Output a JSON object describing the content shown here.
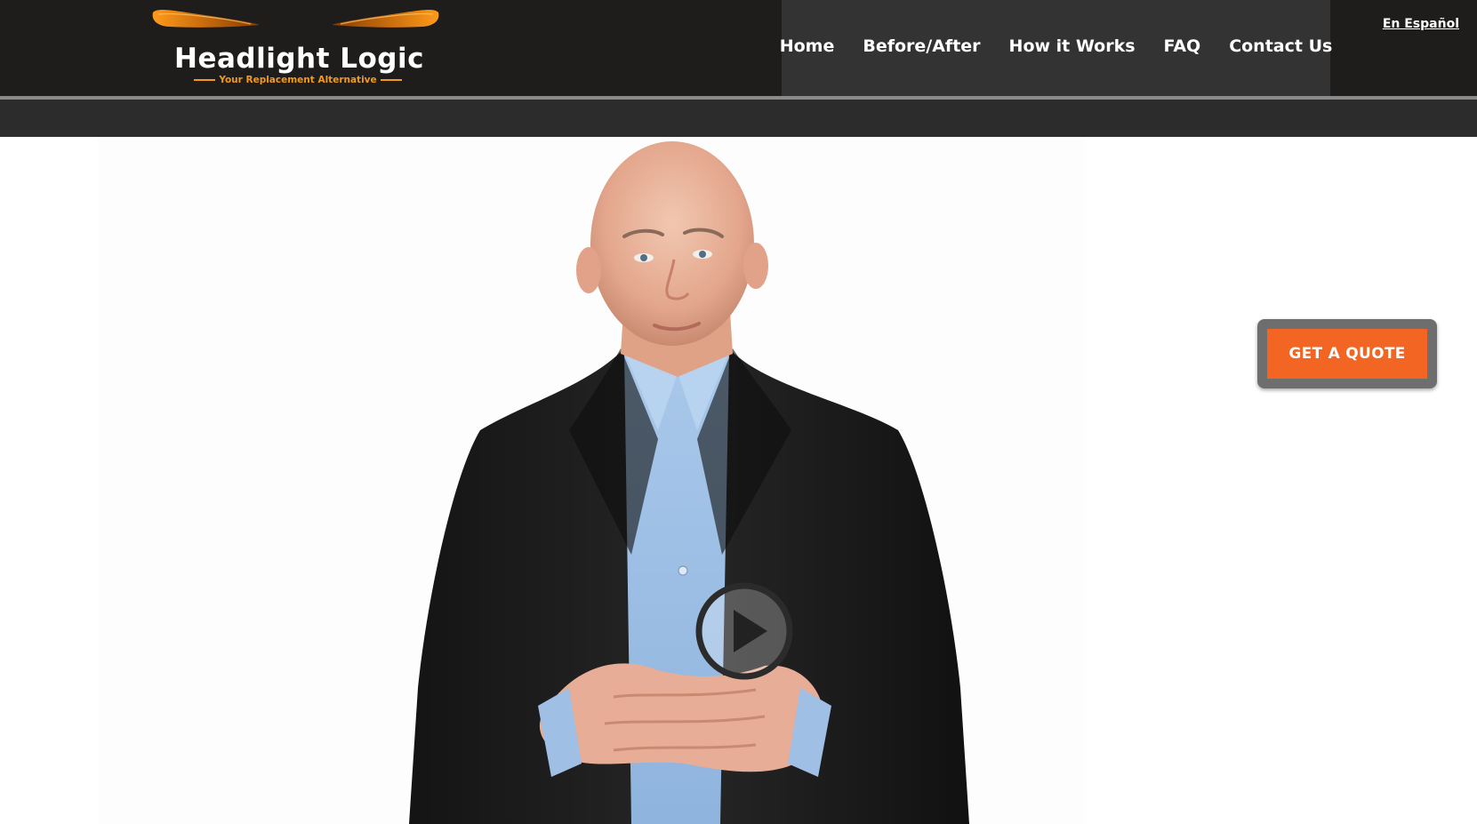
{
  "brand": {
    "name": "Headlight Logic",
    "tagline": "Your Replacement Alternative",
    "accent_color": "#f19a1b"
  },
  "nav": {
    "items": [
      {
        "label": "Home"
      },
      {
        "label": "Before/After"
      },
      {
        "label": "How it Works"
      },
      {
        "label": "FAQ"
      },
      {
        "label": "Contact Us"
      }
    ]
  },
  "language_link": "En Español",
  "cta": {
    "label": "GET A QUOTE",
    "color": "#f26522"
  },
  "video": {
    "play_icon": "play-icon"
  }
}
